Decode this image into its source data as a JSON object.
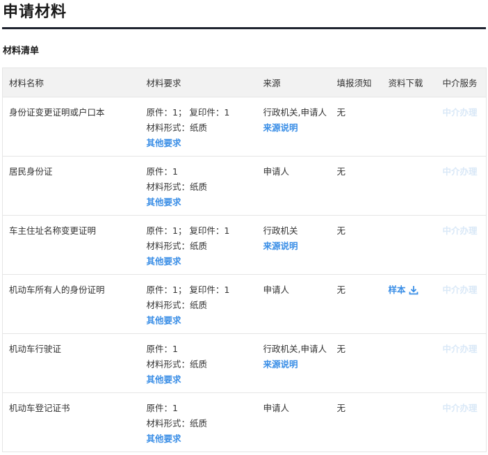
{
  "page": {
    "title": "申请材料",
    "subtitle": "材料清单"
  },
  "table": {
    "headers": [
      "材料名称",
      "材料要求",
      "来源",
      "填报须知",
      "资料下载",
      "中介服务"
    ],
    "rows": [
      {
        "name": "身份证变更证明或户口本",
        "req_line1": "原件：1； 复印件：1",
        "req_line2": "材料形式：纸质",
        "req_link": "其他要求",
        "source": "行政机关,申请人",
        "source_link": "来源说明",
        "notice": "无",
        "download": "",
        "agency": "中介办理"
      },
      {
        "name": "居民身份证",
        "req_line1": "原件：1",
        "req_line2": "材料形式：纸质",
        "req_link": "其他要求",
        "source": "申请人",
        "source_link": "",
        "notice": "无",
        "download": "",
        "agency": "中介办理"
      },
      {
        "name": "车主住址名称变更证明",
        "req_line1": "原件：1； 复印件：1",
        "req_line2": "材料形式：纸质",
        "req_link": "其他要求",
        "source": "行政机关",
        "source_link": "来源说明",
        "notice": "无",
        "download": "",
        "agency": "中介办理"
      },
      {
        "name": "机动车所有人的身份证明",
        "req_line1": "原件：1； 复印件：1",
        "req_line2": "材料形式：纸质",
        "req_link": "其他要求",
        "source": "申请人",
        "source_link": "",
        "notice": "无",
        "download": "样本",
        "agency": "中介办理"
      },
      {
        "name": "机动车行驶证",
        "req_line1": "原件：1",
        "req_line2": "材料形式：纸质",
        "req_link": "其他要求",
        "source": "行政机关,申请人",
        "source_link": "来源说明",
        "notice": "无",
        "download": "",
        "agency": "中介办理"
      },
      {
        "name": "机动车登记证书",
        "req_line1": "原件：1",
        "req_line2": "材料形式：纸质",
        "req_link": "其他要求",
        "source": "申请人",
        "source_link": "",
        "notice": "无",
        "download": "",
        "agency": "中介办理"
      }
    ]
  },
  "icons": {
    "download": "download-icon"
  },
  "colors": {
    "link": "#3a8ee6",
    "agency_disabled": "#d9e8f7",
    "rule": "#1f2430",
    "header_bg": "#f2f2f2"
  }
}
